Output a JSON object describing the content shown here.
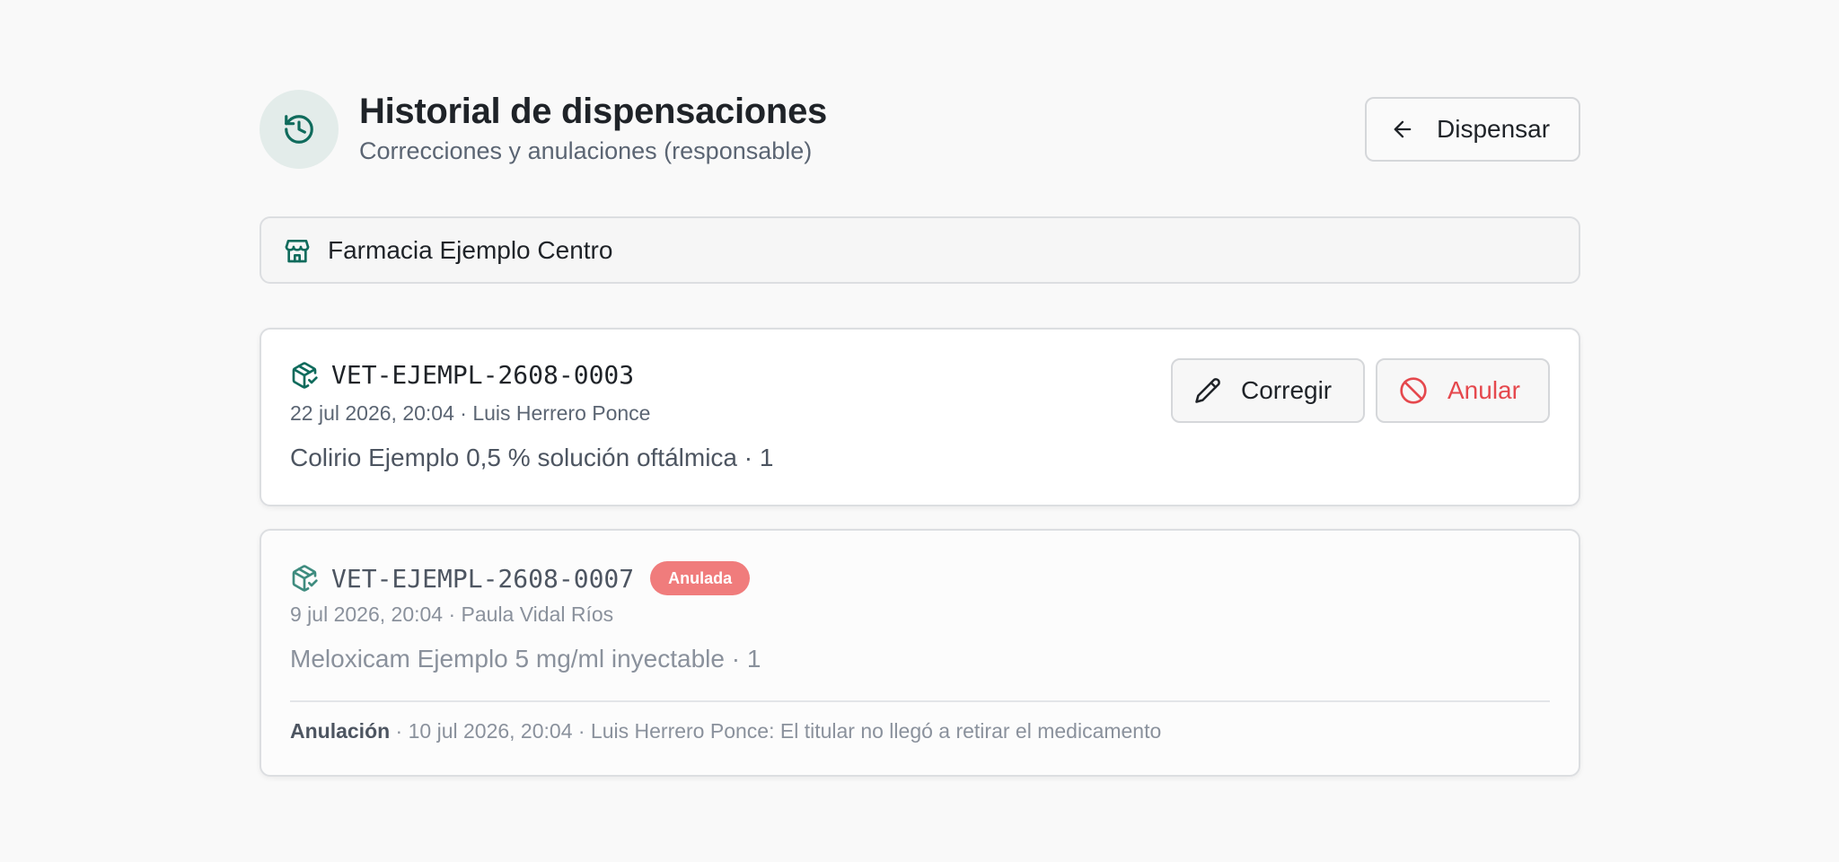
{
  "header": {
    "title": "Historial de dispensaciones",
    "subtitle": "Correcciones y anulaciones (responsable)",
    "back_button": "Dispensar"
  },
  "pharmacy": {
    "name": "Farmacia Ejemplo Centro"
  },
  "dispensations": [
    {
      "id": "VET-EJEMPL-2608-0003",
      "meta": "22 jul 2026, 20:04 · Luis Herrero Ponce",
      "product": "Colirio Ejemplo 0,5 % solución oftálmica · 1",
      "edit_label": "Corregir",
      "void_label": "Anular"
    },
    {
      "id": "VET-EJEMPL-2608-0007",
      "status_badge": "Anulada",
      "meta": "9 jul 2026, 20:04 · Paula Vidal Ríos",
      "product": "Meloxicam Ejemplo 5 mg/ml inyectable · 1",
      "void_note_label": "Anulación",
      "void_note_text": " · 10 jul 2026, 20:04 · Luis Herrero Ponce: El titular no llegó a retirar el medicamento"
    }
  ],
  "colors": {
    "accent": "#0f6b5c",
    "danger": "#e5484d",
    "badge_bg": "#f07c7c"
  },
  "icons": {
    "header": "history-icon",
    "back": "arrow-left-icon",
    "pharmacy": "store-icon",
    "dispense": "package-check-icon",
    "edit": "pencil-icon",
    "void": "ban-icon"
  }
}
